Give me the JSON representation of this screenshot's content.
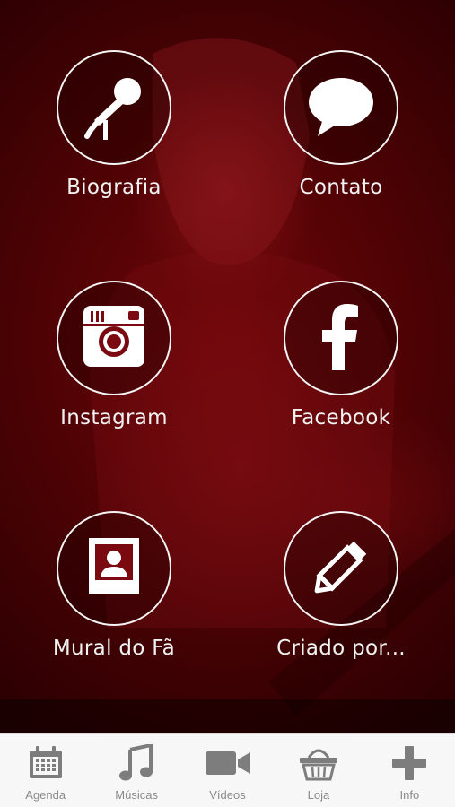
{
  "menu": {
    "items": [
      {
        "label": "Biografia",
        "icon": "microphone-icon"
      },
      {
        "label": "Contato",
        "icon": "speech-bubble-icon"
      },
      {
        "label": "Instagram",
        "icon": "instagram-icon"
      },
      {
        "label": "Facebook",
        "icon": "facebook-icon"
      },
      {
        "label": "Mural do Fã",
        "icon": "portrait-icon"
      },
      {
        "label": "Criado por...",
        "icon": "pencil-icon"
      }
    ]
  },
  "tabbar": {
    "items": [
      {
        "label": "Agenda",
        "icon": "calendar-icon"
      },
      {
        "label": "Músicas",
        "icon": "music-note-icon"
      },
      {
        "label": "Vídeos",
        "icon": "video-camera-icon"
      },
      {
        "label": "Loja",
        "icon": "shopping-basket-icon"
      },
      {
        "label": "Info",
        "icon": "plus-icon"
      }
    ]
  },
  "colors": {
    "background": "#4a0204",
    "tint": "#b0101a",
    "tab_icon": "#7d7d7d",
    "tab_bar": "#f7f7f7"
  }
}
